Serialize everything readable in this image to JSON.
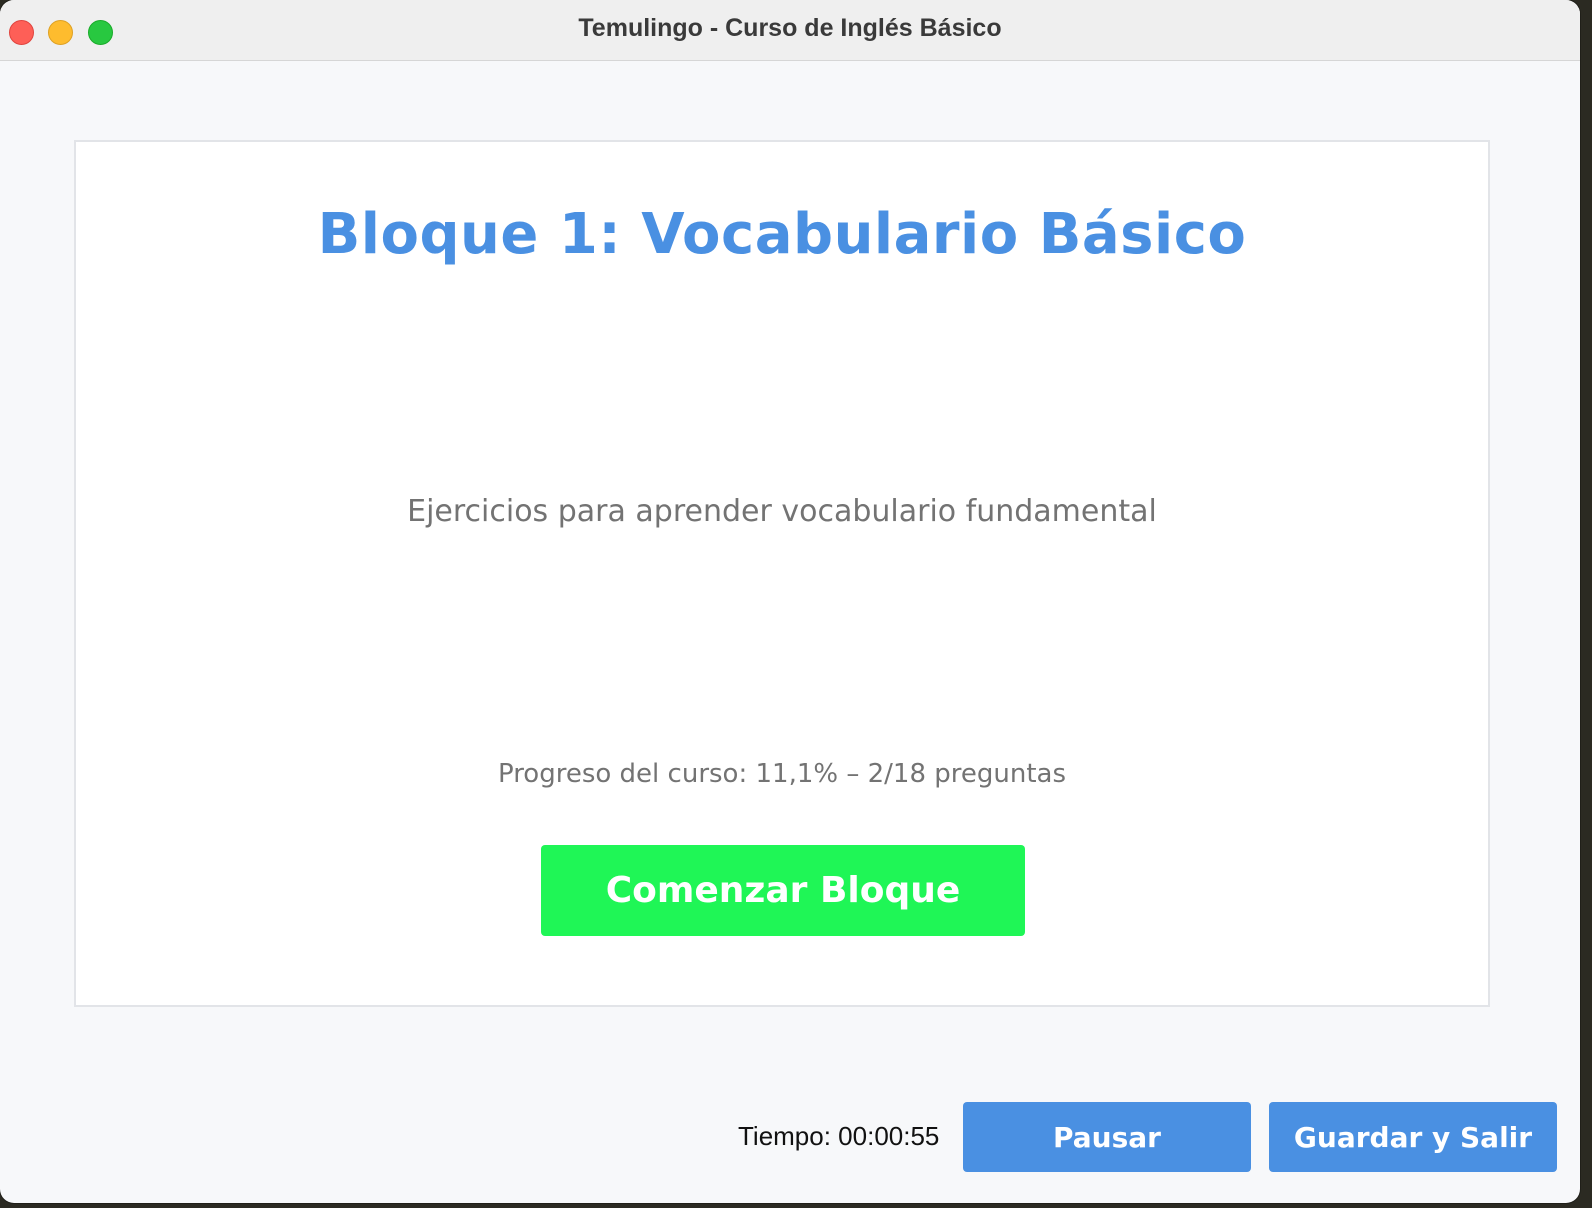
{
  "window": {
    "title": "Temulingo - Curso de Inglés Básico"
  },
  "block": {
    "title": "Bloque 1: Vocabulario Básico",
    "description": "Ejercicios para aprender vocabulario fundamental",
    "progress_text": "Progreso del curso: 11,1% – 2/18 preguntas",
    "progress_percent": 11.1,
    "questions_done": 2,
    "questions_total": 18,
    "start_label": "Comenzar Bloque"
  },
  "footer": {
    "timer_text": "Tiempo: 00:00:55",
    "pause_label": "Pausar",
    "save_exit_label": "Guardar y Salir"
  },
  "colors": {
    "accent_blue": "#4a90e2",
    "start_green": "#1ff656",
    "text_gray": "#737373"
  },
  "icons": {
    "close": "close-icon",
    "minimize": "minimize-icon",
    "zoom": "zoom-icon"
  }
}
